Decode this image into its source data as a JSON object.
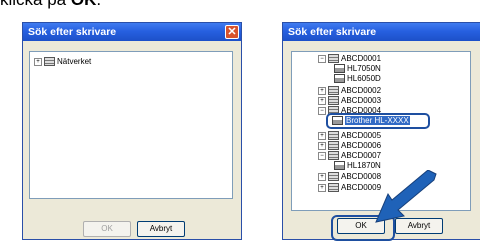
{
  "caption": {
    "prefix": "klicka på ",
    "bold": "OK",
    "suffix": "."
  },
  "dialog_left": {
    "title": "Sök efter skrivare",
    "tree": [
      {
        "label": "Nätverket"
      }
    ],
    "ok_label": "OK",
    "cancel_label": "Avbryt"
  },
  "dialog_right": {
    "title": "Sök efter skrivare",
    "tree": [
      {
        "label": "ABCD0001",
        "type": "server"
      },
      {
        "label": "HL7050N",
        "type": "printer"
      },
      {
        "label": "HL6050D",
        "type": "printer"
      },
      {
        "label": "ABCD0002",
        "type": "server"
      },
      {
        "label": "ABCD0003",
        "type": "server"
      },
      {
        "label": "ABCD0004",
        "type": "server"
      },
      {
        "label": "Brother HL-XXXX",
        "type": "printer",
        "selected": true
      },
      {
        "label": "ABCD0005",
        "type": "server"
      },
      {
        "label": "ABCD0006",
        "type": "server"
      },
      {
        "label": "ABCD0007",
        "type": "server"
      },
      {
        "label": "HL1870N",
        "type": "printer"
      },
      {
        "label": "ABCD0008",
        "type": "server"
      },
      {
        "label": "ABCD0009",
        "type": "server"
      }
    ],
    "ok_label": "OK",
    "cancel_label": "Avbryt"
  },
  "colors": {
    "titlebar": "#2760e0",
    "highlight": "#1e4fa0",
    "arrow": "#1f62b8"
  }
}
